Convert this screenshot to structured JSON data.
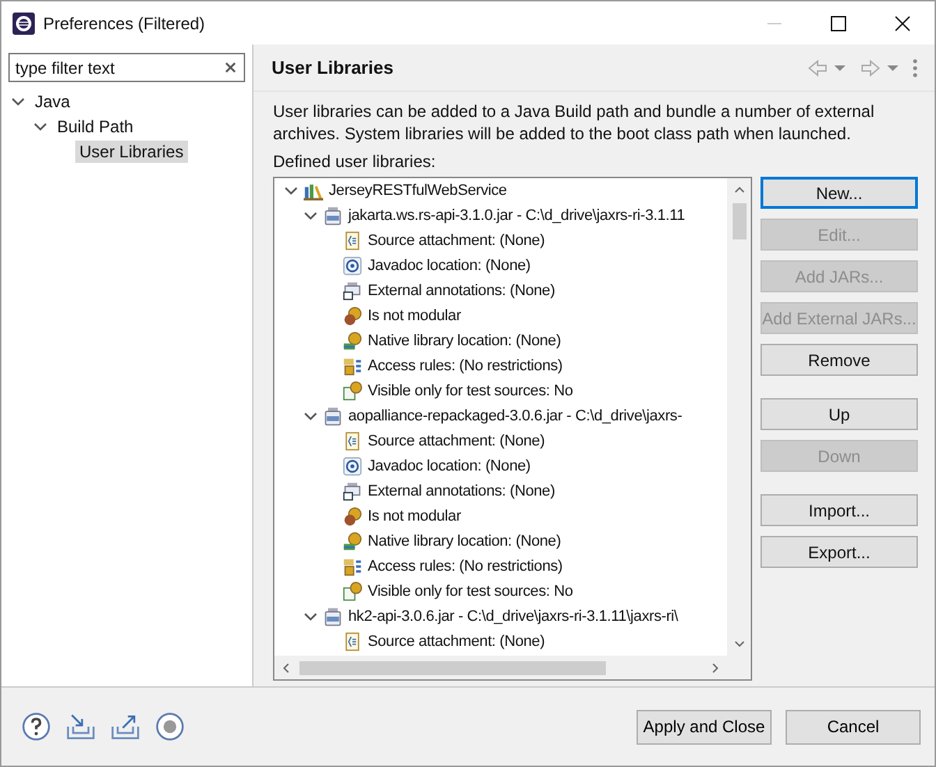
{
  "window": {
    "title": "Preferences (Filtered)"
  },
  "filter": {
    "value": "type filter text"
  },
  "nav": [
    {
      "label": "Java",
      "expanded": true,
      "selected": false,
      "children": [
        {
          "label": "Build Path",
          "expanded": true,
          "selected": false,
          "children": [
            {
              "label": "User Libraries",
              "selected": true
            }
          ]
        }
      ]
    }
  ],
  "page": {
    "title": "User Libraries",
    "description": "User libraries can be added to a Java Build path and bundle a number of external archives. System libraries will be added to the boot class path when launched.",
    "list_label": "Defined user libraries:"
  },
  "libraries": [
    {
      "label": "JerseyRESTfulWebService",
      "kind": "library",
      "expanded": true,
      "children": [
        {
          "label": "jakarta.ws.rs-api-3.1.0.jar - C:\\d_drive\\jaxrs-ri-3.1.11",
          "kind": "jar",
          "expanded": true,
          "children": [
            {
              "label": "Source attachment: (None)",
              "kind": "source"
            },
            {
              "label": "Javadoc location: (None)",
              "kind": "javadoc"
            },
            {
              "label": "External annotations: (None)",
              "kind": "annotations"
            },
            {
              "label": "Is not modular",
              "kind": "module"
            },
            {
              "label": "Native library location: (None)",
              "kind": "native"
            },
            {
              "label": "Access rules: (No restrictions)",
              "kind": "access"
            },
            {
              "label": "Visible only for test sources: No",
              "kind": "test"
            }
          ]
        },
        {
          "label": "aopalliance-repackaged-3.0.6.jar - C:\\d_drive\\jaxrs-",
          "kind": "jar",
          "expanded": true,
          "children": [
            {
              "label": "Source attachment: (None)",
              "kind": "source"
            },
            {
              "label": "Javadoc location: (None)",
              "kind": "javadoc"
            },
            {
              "label": "External annotations: (None)",
              "kind": "annotations"
            },
            {
              "label": "Is not modular",
              "kind": "module"
            },
            {
              "label": "Native library location: (None)",
              "kind": "native"
            },
            {
              "label": "Access rules: (No restrictions)",
              "kind": "access"
            },
            {
              "label": "Visible only for test sources: No",
              "kind": "test"
            }
          ]
        },
        {
          "label": "hk2-api-3.0.6.jar - C:\\d_drive\\jaxrs-ri-3.1.11\\jaxrs-ri\\",
          "kind": "jar",
          "expanded": true,
          "children": [
            {
              "label": "Source attachment: (None)",
              "kind": "source"
            }
          ]
        }
      ]
    }
  ],
  "button_groups": [
    {
      "buttons": [
        {
          "label": "New...",
          "disabled": false,
          "default": true
        },
        {
          "label": "Edit...",
          "disabled": true,
          "default": false
        },
        {
          "label": "Add JARs...",
          "disabled": true,
          "default": false
        },
        {
          "label": "Add External JARs...",
          "disabled": true,
          "default": false
        },
        {
          "label": "Remove",
          "disabled": false,
          "default": false
        }
      ]
    },
    {
      "buttons": [
        {
          "label": "Up",
          "disabled": false,
          "default": false
        },
        {
          "label": "Down",
          "disabled": true,
          "default": false
        }
      ]
    },
    {
      "buttons": [
        {
          "label": "Import...",
          "disabled": false,
          "default": false
        },
        {
          "label": "Export...",
          "disabled": false,
          "default": false
        }
      ]
    }
  ],
  "footer": {
    "buttons": [
      {
        "label": "Apply and Close"
      },
      {
        "label": "Cancel"
      }
    ]
  }
}
